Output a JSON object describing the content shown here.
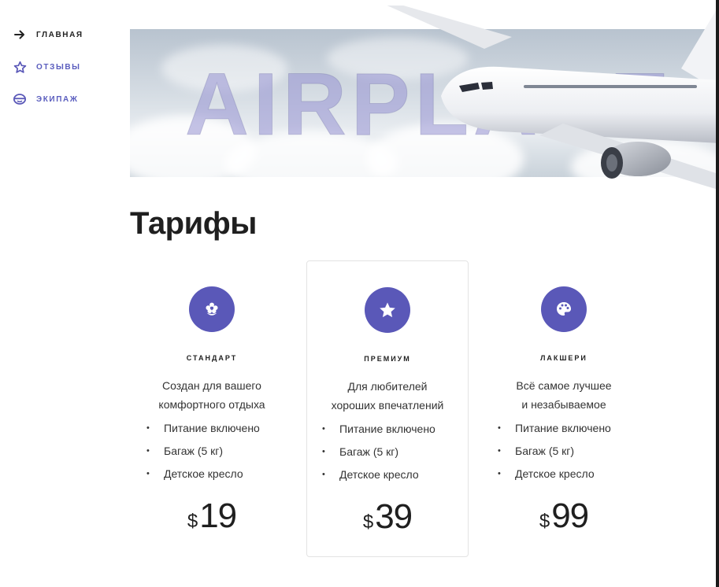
{
  "nav": {
    "items": [
      {
        "label": "ГЛАВНАЯ",
        "icon": "arrow-right-icon"
      },
      {
        "label": "ОТЗЫВЫ",
        "icon": "star-outline-icon"
      },
      {
        "label": "ЭКИПАЖ",
        "icon": "crew-icon"
      }
    ]
  },
  "hero": {
    "word": "AIRPLANE"
  },
  "section": {
    "title": "Тарифы"
  },
  "plans": [
    {
      "name": "СТАНДАРТ",
      "icon": "flower-icon",
      "desc_line1": "Создан для вашего",
      "desc_line2": "комфортного отдыха",
      "features": [
        "Питание включено",
        "Багаж (5 кг)",
        "Детское кресло"
      ],
      "currency": "$",
      "price": "19"
    },
    {
      "name": "ПРЕМИУМ",
      "icon": "star-icon",
      "desc_line1": "Для любителей",
      "desc_line2": "хороших впечатлений",
      "features": [
        "Питание включено",
        "Багаж (5 кг)",
        "Детское кресло"
      ],
      "currency": "$",
      "price": "39"
    },
    {
      "name": "ЛАКШЕРИ",
      "icon": "palette-icon",
      "desc_line1": "Всё самое лучшее",
      "desc_line2": "и незабываемое",
      "features": [
        "Питание включено",
        "Багаж (5 кг)",
        "Детское кресло"
      ],
      "currency": "$",
      "price": "99"
    }
  ],
  "colors": {
    "accent": "#5a58b8",
    "text": "#222222",
    "nav_label_accent": "#5a5dbe"
  }
}
